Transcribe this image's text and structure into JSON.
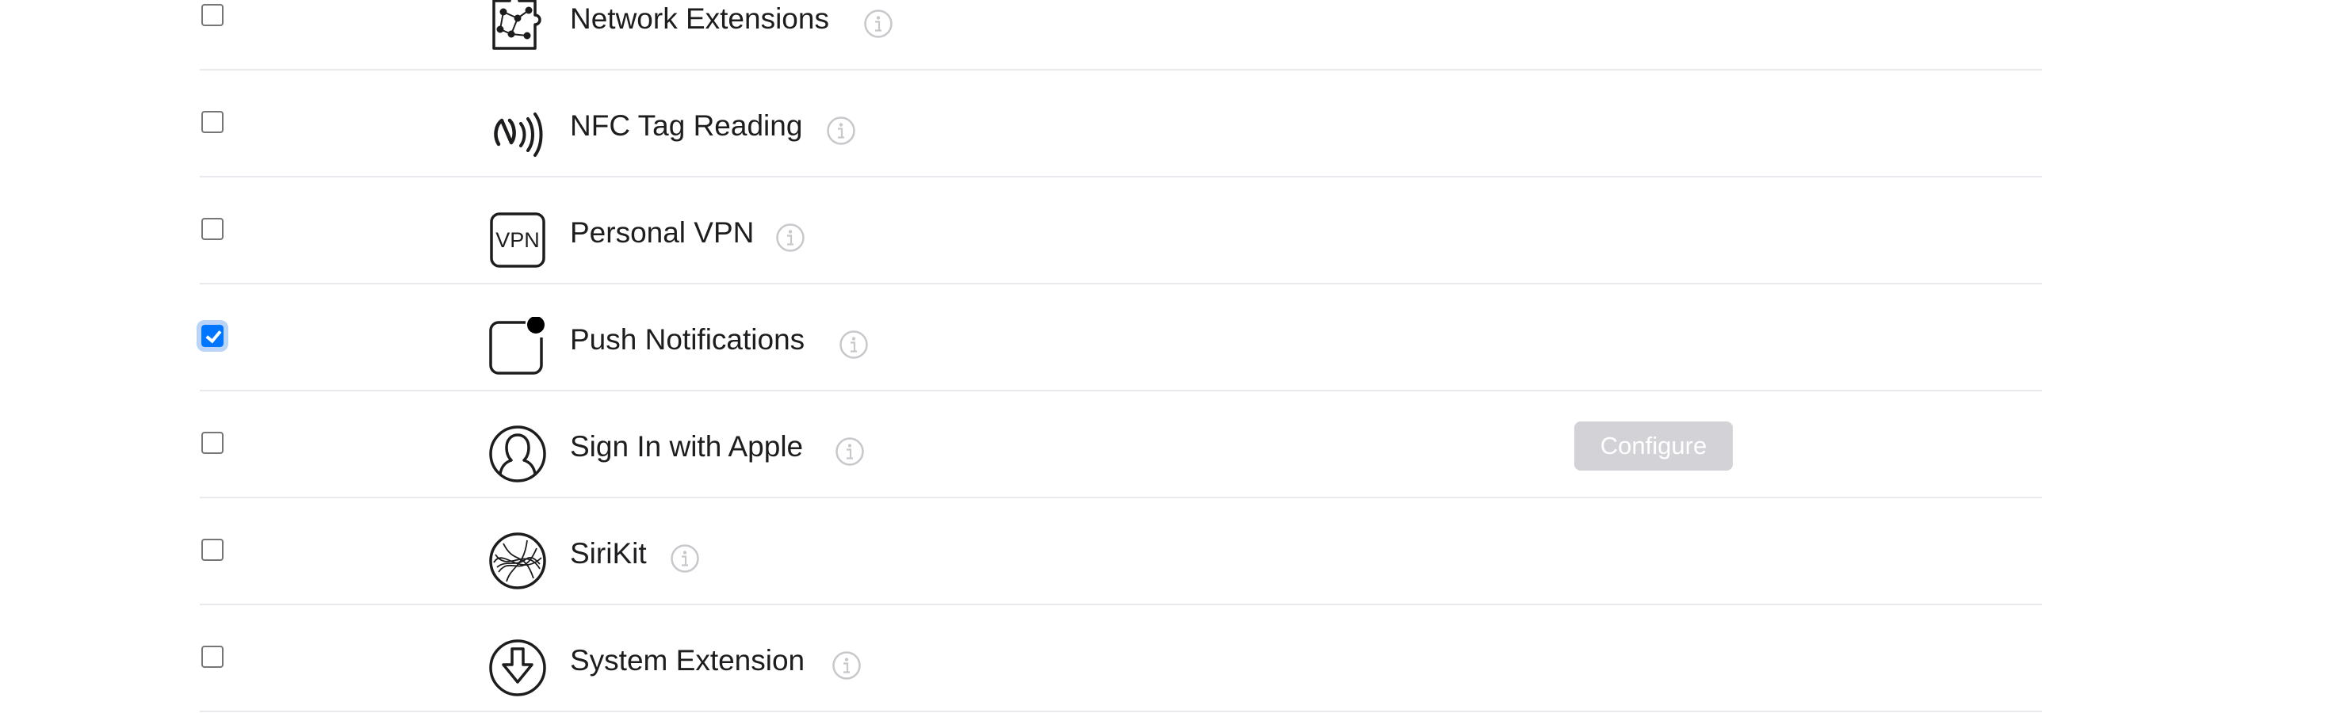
{
  "capabilities": {
    "rows": [
      {
        "label": "Network Extensions",
        "checked": false,
        "icon": "network-extensions-icon"
      },
      {
        "label": "NFC Tag Reading",
        "checked": false,
        "icon": "nfc-icon"
      },
      {
        "label": "Personal VPN",
        "checked": false,
        "icon": "vpn-icon",
        "icon_text": "VPN"
      },
      {
        "label": "Push Notifications",
        "checked": true,
        "icon": "push-notifications-icon"
      },
      {
        "label": "Sign In with Apple",
        "checked": false,
        "icon": "sign-in-with-apple-icon",
        "action": "Configure"
      },
      {
        "label": "SiriKit",
        "checked": false,
        "icon": "sirikit-icon"
      },
      {
        "label": "System Extension",
        "checked": false,
        "icon": "system-extension-icon"
      }
    ]
  },
  "colors": {
    "text": "#1d1d1f",
    "divider": "#e8e8ed",
    "checkbox_checked": "#0075ff",
    "info_icon": "#c7c7cc",
    "configure_disabled_bg": "#d2d2d7"
  },
  "info_icon_name": "info-icon"
}
